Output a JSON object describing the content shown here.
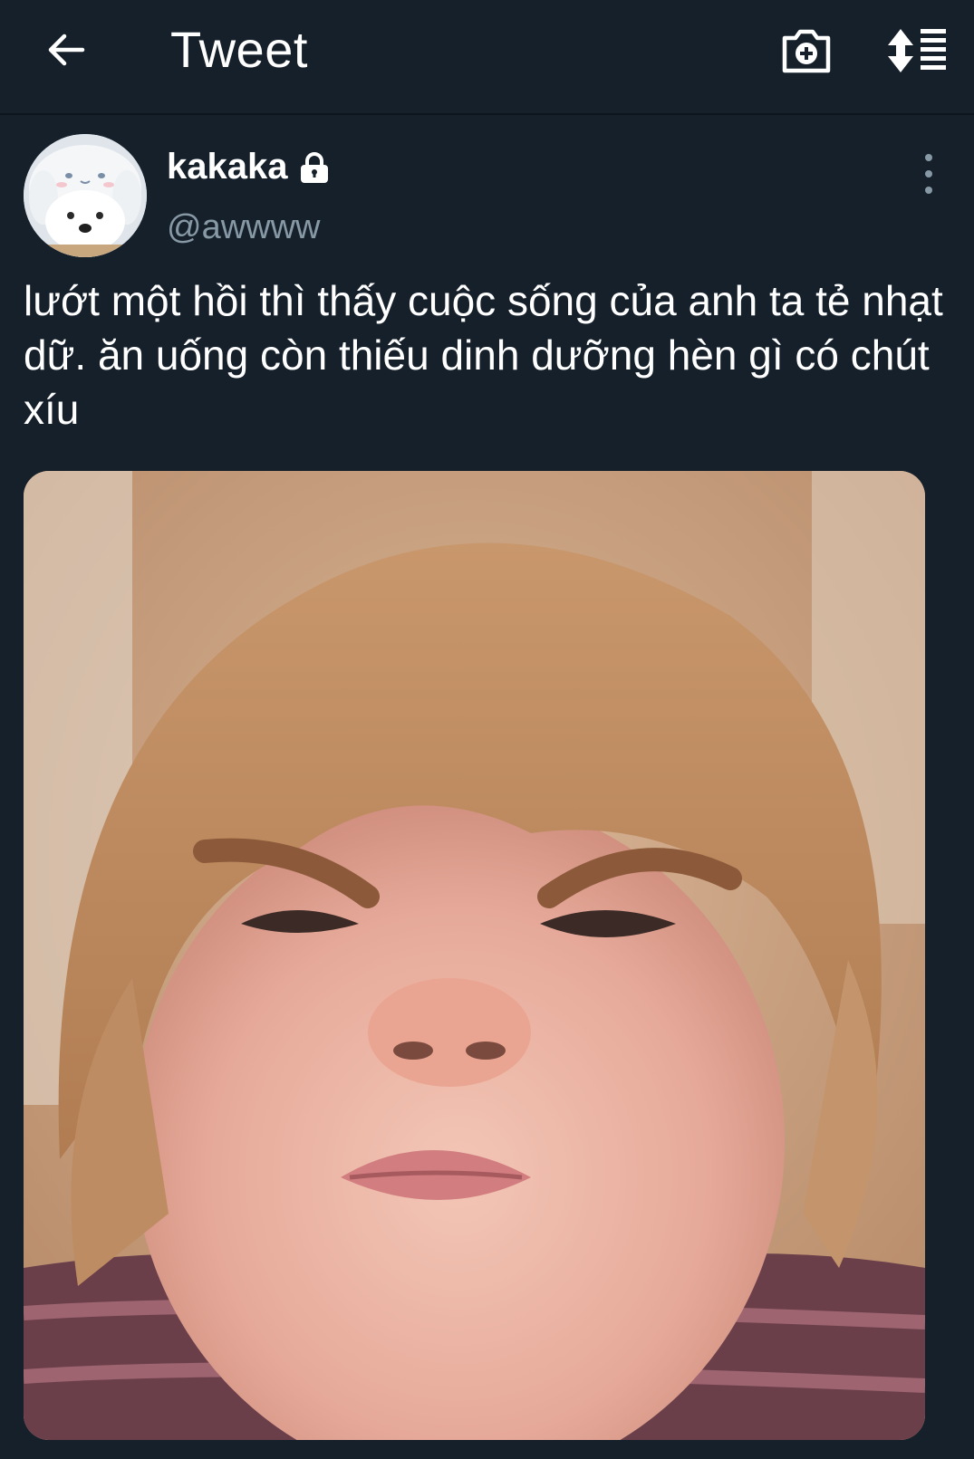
{
  "header": {
    "title": "Tweet",
    "back_icon": "arrow-left-icon",
    "camera_icon": "camera-add-icon",
    "sort_icon": "sort-list-icon"
  },
  "tweet": {
    "display_name": "kakaka",
    "protected_icon": "lock-icon",
    "handle": "@awwww",
    "text": "lướt một hồi thì thấy cuộc sống của anh ta tẻ nhạt dữ. ăn uống còn thiếu dinh dưỡng hèn gì có chút xíu",
    "more_icon": "more-vertical-icon"
  },
  "colors": {
    "background": "#15202b",
    "text_primary": "#ffffff",
    "text_secondary": "#8899a6"
  }
}
